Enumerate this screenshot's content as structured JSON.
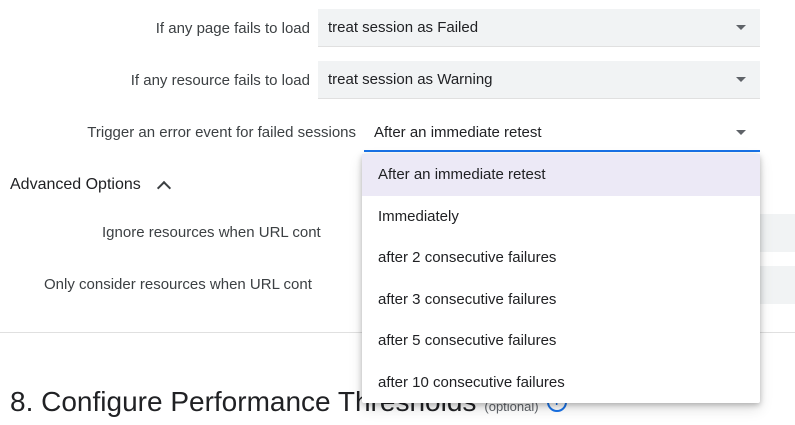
{
  "settings": {
    "page_fail": {
      "label": "If any page fails to load",
      "value": "treat session as Failed"
    },
    "resource_fail": {
      "label": "If any resource fails to load",
      "value": "treat session as Warning"
    },
    "error_event": {
      "label": "Trigger an error event for failed sessions",
      "value": "After an immediate retest"
    }
  },
  "advanced": {
    "label": "Advanced Options",
    "ignore_label": "Ignore resources when URL cont",
    "only_label": "Only consider resources when URL cont"
  },
  "dropdown": {
    "options": [
      "After an immediate retest",
      "Immediately",
      "after 2 consecutive failures",
      "after 3 consecutive failures",
      "after 5 consecutive failures",
      "after 10 consecutive failures"
    ],
    "selected": "After an immediate retest"
  },
  "next_section": {
    "title": "8. Configure Performance Thresholds",
    "optional": "(optional)",
    "info_icon": "info-icon"
  },
  "colors": {
    "accent": "#1a73e8",
    "field_bg": "#f1f3f4",
    "selected_option_bg": "#ece9f6"
  }
}
